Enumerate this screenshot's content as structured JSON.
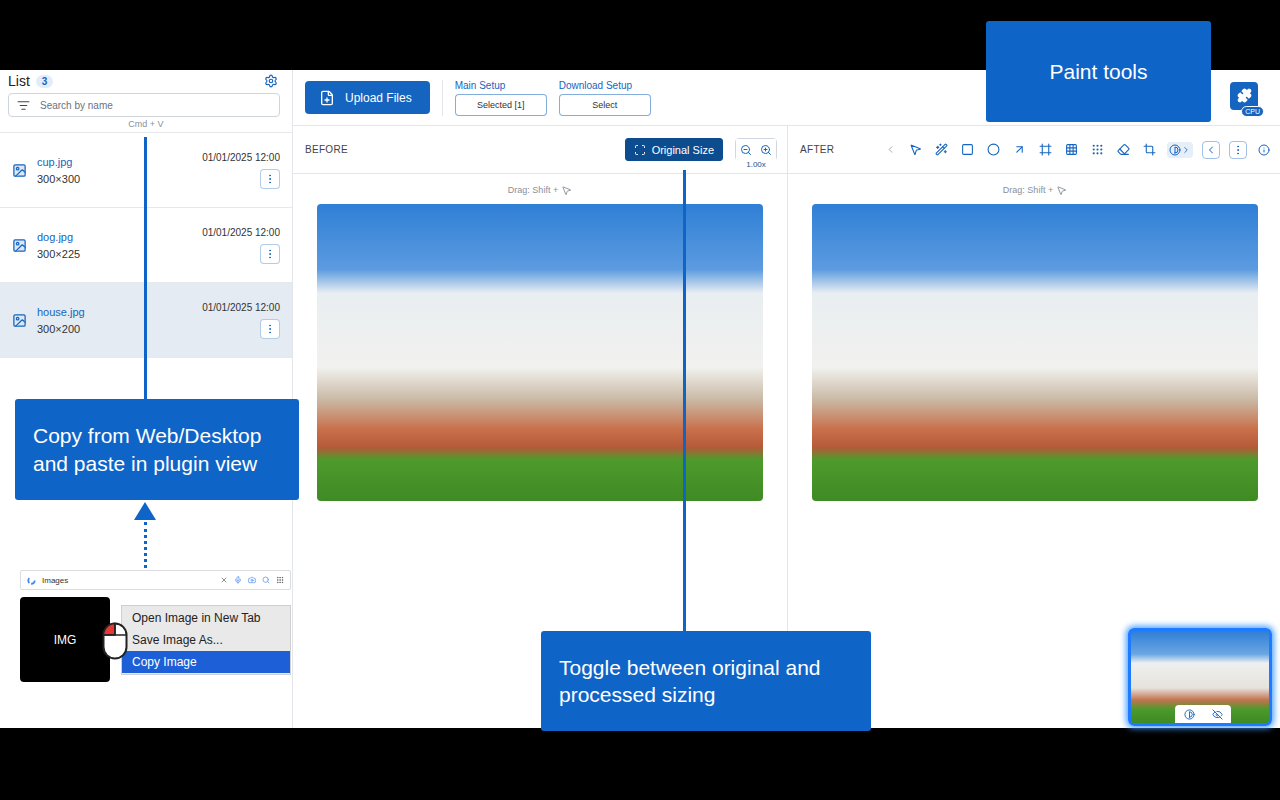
{
  "sidebar": {
    "title": "List",
    "count": "3",
    "search_placeholder": "Search by name",
    "paste_hint": "Cmd + V",
    "items": [
      {
        "name": "cup.jpg",
        "size": "300×300",
        "date": "01/01/2025 12:00",
        "selected": false
      },
      {
        "name": "dog.jpg",
        "size": "300×225",
        "date": "01/01/2025 12:00",
        "selected": false
      },
      {
        "name": "house.jpg",
        "size": "300×200",
        "date": "01/01/2025 12:00",
        "selected": true
      }
    ]
  },
  "toolbar": {
    "upload": "Upload Files",
    "main_setup": {
      "label": "Main Setup",
      "value": "Selected [1]"
    },
    "download_setup": {
      "label": "Download Setup",
      "value": "Select"
    },
    "plugin_badge": "CPU"
  },
  "before": {
    "label": "BEFORE",
    "original_size": "Original Size",
    "original_size_selected": true,
    "zoom": "1.00x",
    "drag_hint": "Drag: Shift +"
  },
  "after": {
    "label": "AFTER",
    "drag_hint": "Drag: Shift +"
  },
  "callouts": {
    "paint_tools": "Paint tools",
    "paste": "Copy from Web/Desktop and paste in plugin view",
    "toggle": "Toggle between original and processed sizing"
  },
  "demo": {
    "search": "Images",
    "image_label": "IMG",
    "menu": [
      {
        "label": "Open Image in New Tab",
        "selected": false
      },
      {
        "label": "Save Image As...",
        "selected": false
      },
      {
        "label": "Copy Image",
        "selected": true
      }
    ]
  }
}
